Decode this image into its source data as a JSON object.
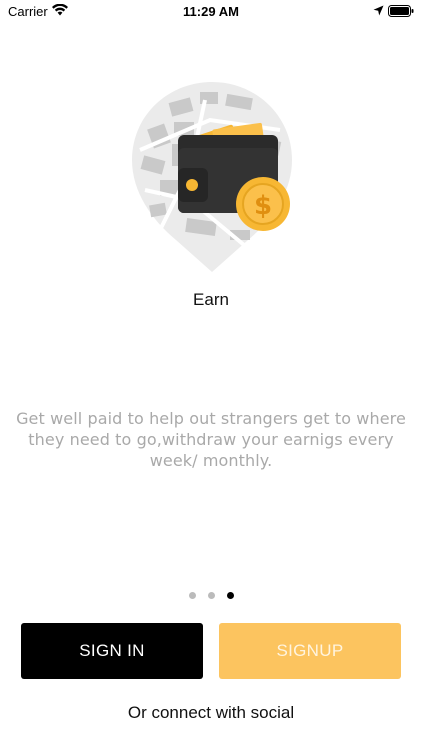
{
  "status_bar": {
    "carrier": "Carrier",
    "time": "11:29 AM"
  },
  "onboarding": {
    "title": "Earn",
    "description": "Get well paid to help out strangers get to where they need to go,withdraw your earnigs every week/ monthly.",
    "page_count": 3,
    "active_page": 3
  },
  "actions": {
    "signin_label": "SIGN IN",
    "signup_label": "SIGNUP",
    "social_label": "Or connect with social"
  },
  "colors": {
    "primary": "#000000",
    "accent": "#fcc45f",
    "muted_text": "#a9a9a9"
  },
  "icons": {
    "illustration": "wallet-with-coin-on-map-pin",
    "wifi": "wifi-icon",
    "location": "location-arrow-icon",
    "battery": "battery-icon"
  }
}
